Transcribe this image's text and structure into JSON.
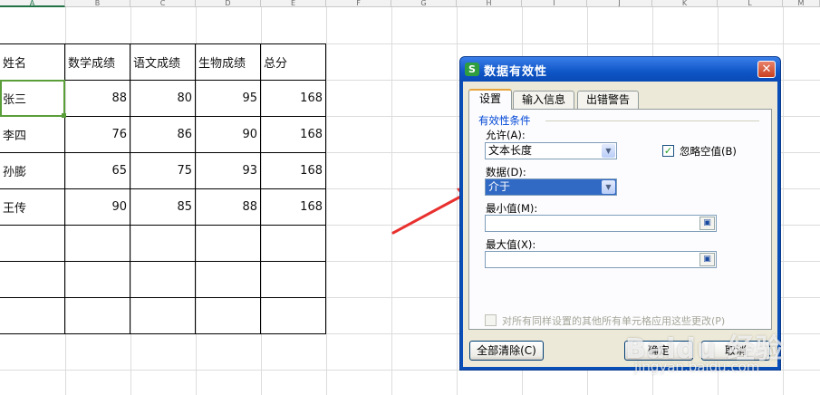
{
  "spreadsheet": {
    "column_headers": [
      "A",
      "B",
      "C",
      "D",
      "E",
      "F",
      "G",
      "H",
      "I",
      "J",
      "K",
      "L",
      "M"
    ],
    "table": {
      "headers": [
        "姓名",
        "数学成绩",
        "语文成绩",
        "生物成绩",
        "总分"
      ],
      "rows": [
        [
          "张三",
          "88",
          "80",
          "95",
          "168"
        ],
        [
          "李四",
          "76",
          "86",
          "90",
          "168"
        ],
        [
          "孙膨",
          "65",
          "75",
          "93",
          "168"
        ],
        [
          "王传",
          "90",
          "85",
          "88",
          "168"
        ]
      ]
    }
  },
  "dialog": {
    "title": "数据有效性",
    "app_icon_letter": "S",
    "close_glyph": "✕",
    "tabs": [
      "设置",
      "输入信息",
      "出错警告"
    ],
    "group_title": "有效性条件",
    "allow_label": "允许(A):",
    "allow_value": "文本长度",
    "ignore_blank_label": "忽略空值(B)",
    "ignore_blank_checked": true,
    "data_label": "数据(D):",
    "data_value": "介于",
    "min_label": "最小值(M):",
    "max_label": "最大值(X):",
    "apply_all_label": "对所有同样设置的其他所有单元格应用这些更改(P)",
    "clear_all_button": "全部清除(C)",
    "ok_button": "确定",
    "cancel_button": "取消"
  },
  "watermark": {
    "line1": "Baidu 经验",
    "line2": "jingyan.baidu.com"
  },
  "colors": {
    "dialog_title_bar": "#0f56c7",
    "selected_cell_border": "#5a9e3a",
    "arrow": "#e8312f",
    "tab_highlight": "#e6a53b"
  },
  "icons": [
    "app-s-icon",
    "close-icon",
    "chevron-down-icon",
    "range-select-icon",
    "checkmark-icon",
    "red-arrow"
  ]
}
